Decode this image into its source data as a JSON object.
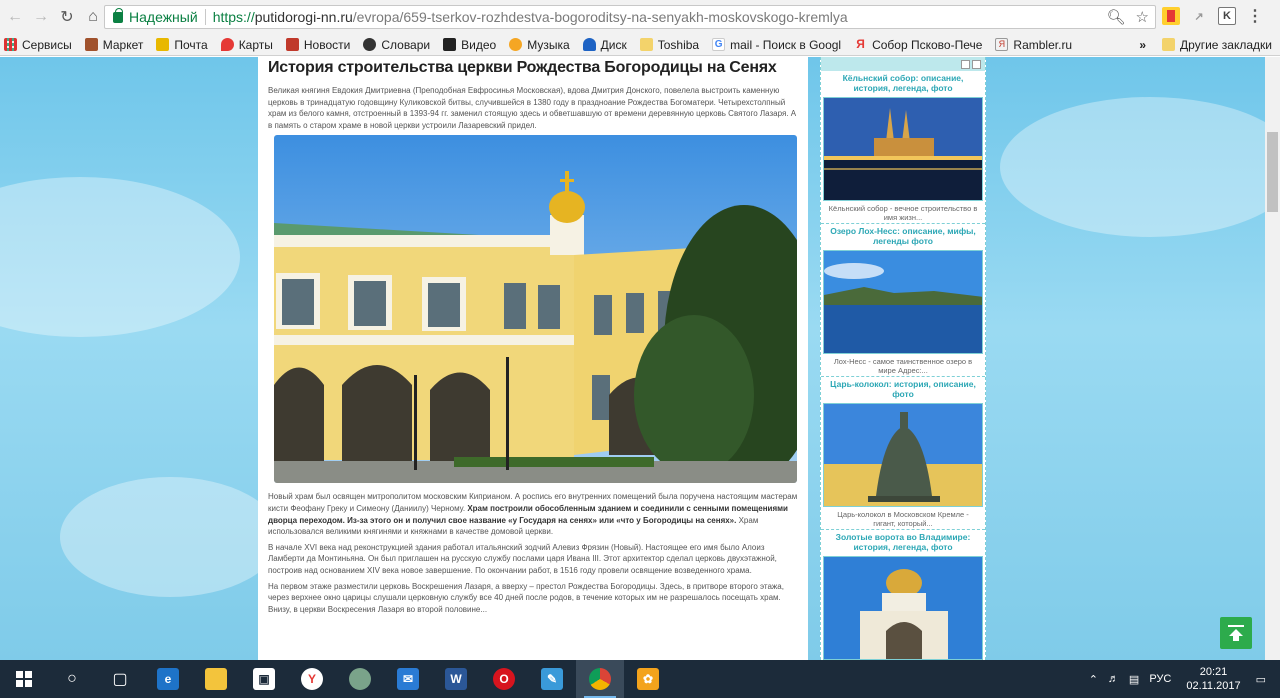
{
  "browser": {
    "secure_label": "Надежный",
    "url_scheme": "https://",
    "url_host": "putidorogi-nn.ru",
    "url_path": "/evropa/659-tserkov-rozhdestva-bogoroditsy-na-senyakh-moskovskogo-kremlya"
  },
  "bookmarks": {
    "items": [
      "Сервисы",
      "Маркет",
      "Почта",
      "Карты",
      "Новости",
      "Словари",
      "Видео",
      "Музыка",
      "Диск",
      "Toshiba",
      "mail - Поиск в Googl",
      "Собор Псково-Пече",
      "Rambler.ru"
    ],
    "more": "»",
    "other": "Другие закладки"
  },
  "article": {
    "title": "История строительства церкви Рождества Богородицы на Сенях",
    "p1": "Великая княгиня Евдокия Дмитриевна (Преподобная Евфросинья Московская), вдова Дмитрия Донского, повелела выстроить каменную церковь в тринадцатую годовщину Куликовской битвы, случившейся в 1380 году в праздноание Рождества Богоматери. Четырехстолпный храм из белого камня, отстроенный в 1393-94 гг. заменил стоящую здесь и обветшавшую от времени деревянную церковь Святого Лазаря. А в память о старом храме в новой церкви устроили Лазаревский придел.",
    "p2_a": "Новый храм был освящен митрополитом московским Киприаном. А роспись его внутренних помещений была поручена настоящим мастерам кисти Феофану Греку и Симеону (Даниилу) Черному. ",
    "p2_b": "Храм построили обособленным зданием и соединили с сенными помещениями дворца переходом. Из-за этого он и получил свое название «у Государя на сенях» или «что у Богородицы на сенях».",
    "p2_c": " Храм использовался великими княгинями и княжнами в качестве домовой церкви.",
    "p3": "В начале XVI века над реконструкцией здания работал итальянский зодчий Алевиз Фрязин (Новый). Настоящее его имя было Алоиз Ламберти да Монтиньяна. Он был приглашен на русскую службу послами царя Ивана III. Этот архитектор сделал церковь двухэтажной, построив над основанием XIV века новое завершение. По окончании работ, в 1516 году провели освящение возведенного храма.",
    "p4": "На первом этаже разместили церковь Воскрешения Лазаря, а вверху – престол Рождества Богородицы. Здесь, в притворе второго этажа, через верхнее окно царицы слушали церковную службу все 40 дней после родов, в течение которых им не разрешалось посещать храм. Внизу, в церкви Воскресения Лазаря во второй половине..."
  },
  "sidebar": {
    "items": [
      {
        "title": "Кёльнский собор: описание, история, легенда, фото",
        "caption": "Кёльнский собор - вечное строительство в имя жизн..."
      },
      {
        "title": "Озеро Лох-Несс: описание, мифы, легенды фото",
        "caption": "Лох-Несс - самое таинственное озеро в мире Адрес:..."
      },
      {
        "title": "Царь-колокол: история, описание, фото",
        "caption": "Царь-колокол в Московском Кремле - гигант, который..."
      },
      {
        "title": "Золотые ворота во Владимире: история, легенда, фото",
        "caption": ""
      }
    ]
  },
  "taskbar": {
    "lang": "РУС",
    "time": "20:21",
    "date": "02.11.2017"
  },
  "colors": {
    "accent_teal": "#2ca7b5",
    "secure_green": "#0b8043",
    "to_top_green": "#2dab4c"
  }
}
